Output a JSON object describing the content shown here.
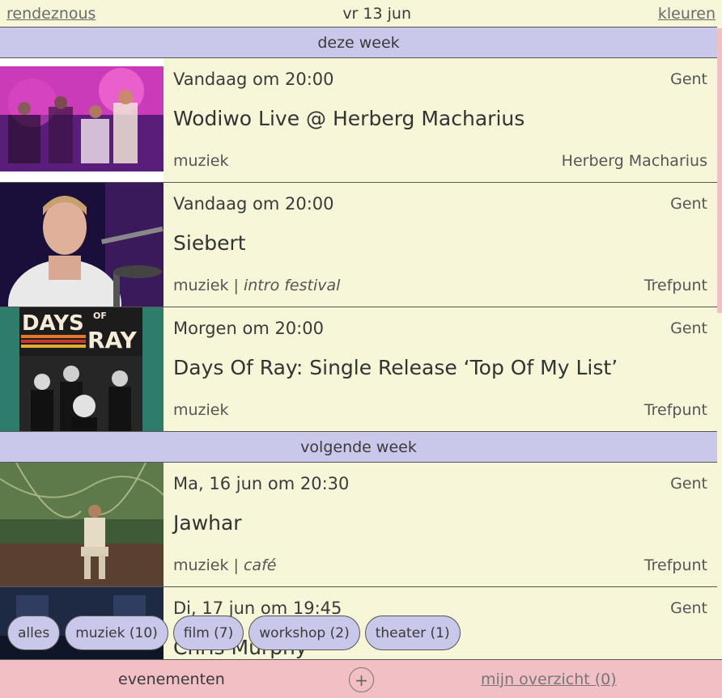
{
  "topbar": {
    "left_link": "rendeznous",
    "date": "vr 13 jun",
    "right_link": "kleuren"
  },
  "sections": [
    {
      "label": "deze week",
      "events": [
        {
          "when": "Vandaag om 20:00",
          "city": "Gent",
          "title": "Wodiwo Live @ Herberg Macharius",
          "category": "muziek",
          "subcategory": "",
          "venue": "Herberg Macharius"
        },
        {
          "when": "Vandaag om 20:00",
          "city": "Gent",
          "title": "Siebert",
          "category": "muziek",
          "subcategory": "intro festival",
          "venue": "Trefpunt"
        },
        {
          "when": "Morgen om 20:00",
          "city": "Gent",
          "title": "Days Of Ray: Single Release ‘Top Of My List’",
          "category": "muziek",
          "subcategory": "",
          "venue": "Trefpunt",
          "poster_line1": "DAYS",
          "poster_of": "OF",
          "poster_line2": "RAY"
        }
      ]
    },
    {
      "label": "volgende week",
      "events": [
        {
          "when": "Ma, 16 jun om 20:30",
          "city": "Gent",
          "title": "Jawhar",
          "category": "muziek",
          "subcategory": "café",
          "venue": "Trefpunt"
        },
        {
          "when": "Di, 17 jun om 19:45",
          "city": "Gent",
          "title": "Chris Murphy",
          "category": "",
          "subcategory": "",
          "venue": ""
        }
      ]
    }
  ],
  "filters": [
    "alles",
    "muziek (10)",
    "film (7)",
    "workshop (2)",
    "theater (1)"
  ],
  "bottombar": {
    "events_label": "evenementen",
    "add_symbol": "+",
    "mine_label": "mijn overzicht (0)"
  },
  "colors": {
    "background": "#f7f6d9",
    "section": "#c9c8ea",
    "bottombar": "#f2bfc4"
  }
}
